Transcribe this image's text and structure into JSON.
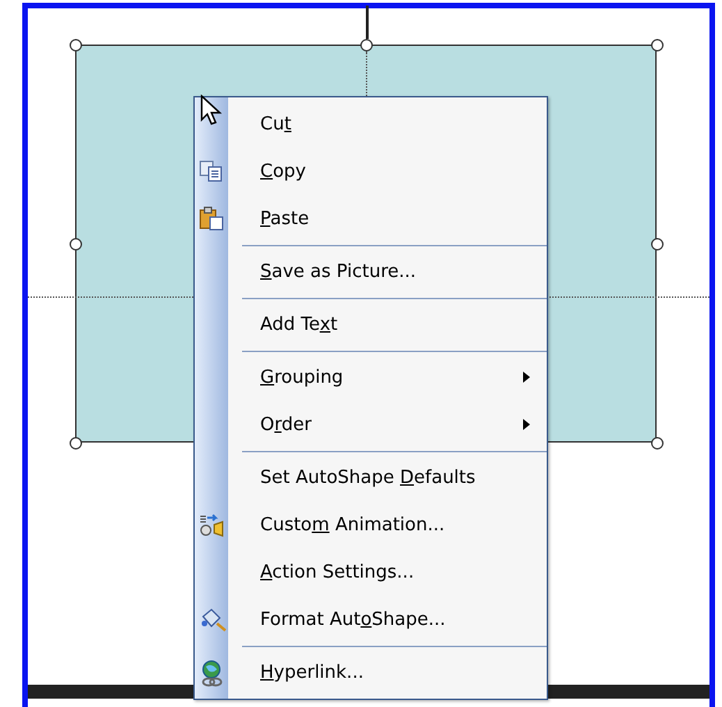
{
  "context_menu": {
    "items": [
      {
        "kind": "item",
        "text_before": "Cu",
        "accelerator": "t",
        "submenu": false
      },
      {
        "kind": "item",
        "accelerator": "C",
        "text_after": "opy",
        "submenu": false
      },
      {
        "kind": "item",
        "accelerator": "P",
        "text_after": "aste",
        "submenu": false
      },
      {
        "kind": "separator"
      },
      {
        "kind": "item",
        "accelerator": "S",
        "text_after": "ave as Picture...",
        "submenu": false
      },
      {
        "kind": "separator"
      },
      {
        "kind": "item",
        "text_before": "Add Te",
        "accelerator": "x",
        "text_after": "t",
        "submenu": false
      },
      {
        "kind": "separator"
      },
      {
        "kind": "item",
        "accelerator": "G",
        "text_after": "rouping",
        "submenu": true
      },
      {
        "kind": "item",
        "text_before": "O",
        "accelerator": "r",
        "text_after": "der",
        "submenu": true
      },
      {
        "kind": "separator"
      },
      {
        "kind": "item",
        "text_before": "Set AutoShape ",
        "accelerator": "D",
        "text_after": "efaults",
        "submenu": false
      },
      {
        "kind": "item",
        "text_before": "Custo",
        "accelerator": "m",
        "text_after": " Animation...",
        "submenu": false
      },
      {
        "kind": "item",
        "accelerator": "A",
        "text_after": "ction Settings...",
        "submenu": false
      },
      {
        "kind": "item",
        "text_before": "Format Aut",
        "accelerator": "o",
        "text_after": "Shape...",
        "submenu": false
      },
      {
        "kind": "separator"
      },
      {
        "kind": "item",
        "accelerator": "H",
        "text_after": "yperlink...",
        "submenu": false
      }
    ]
  }
}
